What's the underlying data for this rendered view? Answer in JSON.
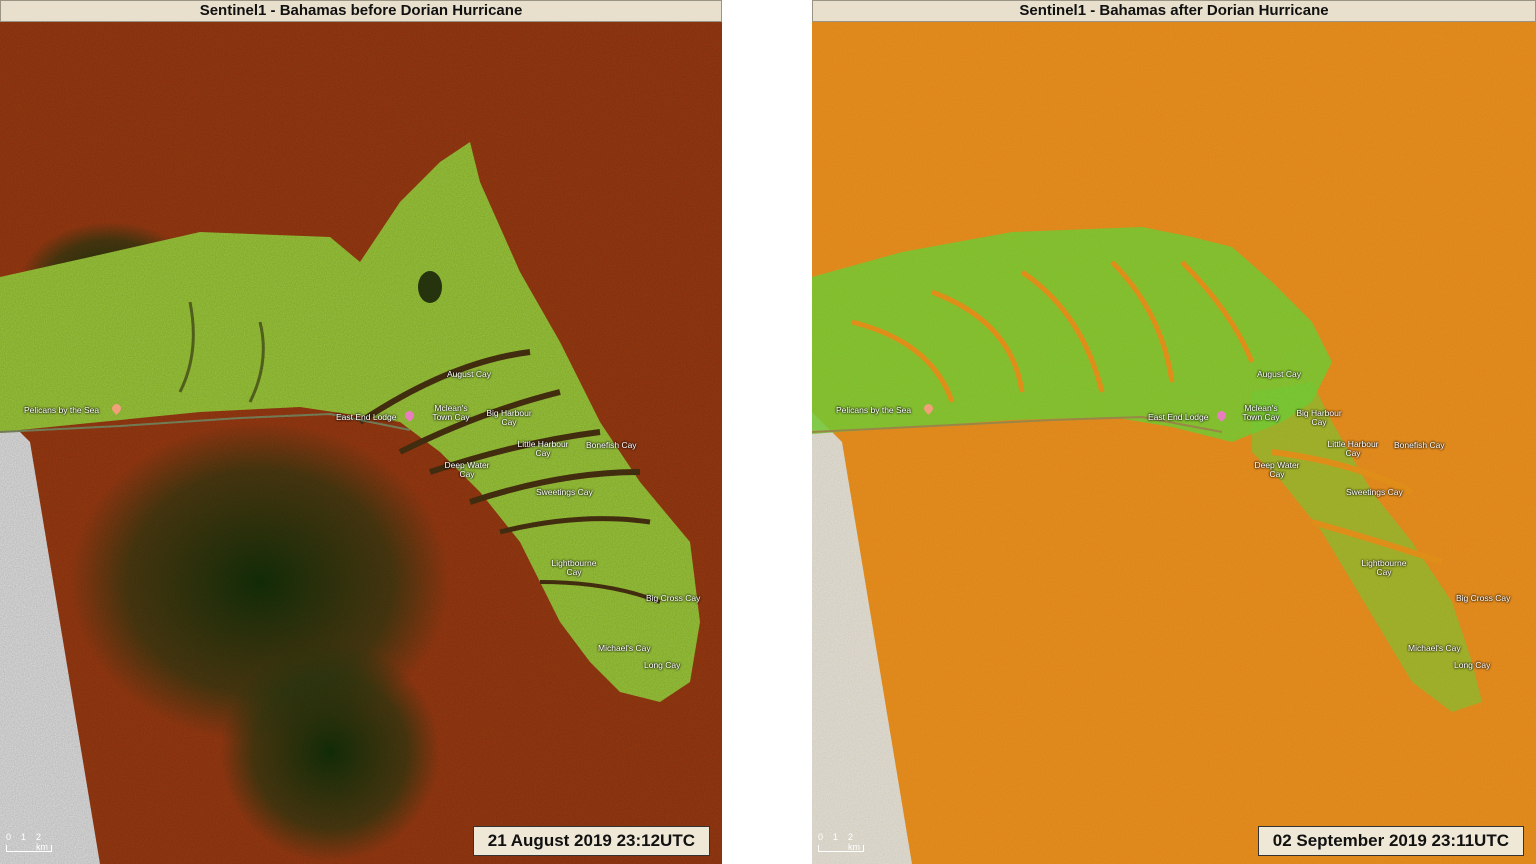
{
  "left": {
    "title": "Sentinel1 - Bahamas before Dorian Hurricane",
    "timestamp": "21 August 2019 23:12UTC",
    "scale": {
      "labels": [
        "0",
        "1",
        "2 km"
      ]
    },
    "colors": {
      "sea": "#9a3a12",
      "sea_dark": "#1f3b10",
      "land": "#9cc83a",
      "channel": "#4a3212",
      "nodata": "#e0e0e0"
    }
  },
  "right": {
    "title": "Sentinel1 - Bahamas after Dorian Hurricane",
    "timestamp": "02 September 2019 23:11UTC",
    "scale": {
      "labels": [
        "0",
        "1",
        "2 km"
      ]
    },
    "colors": {
      "sea": "#e88c20",
      "land": "#6ed23a",
      "channel": "#e8921c",
      "nodata": "#e0e0e0"
    }
  },
  "places": {
    "pelicans": "Pelicans by the Sea",
    "east_end_lodge": "East End Lodge",
    "august_cay": "August Cay",
    "mcleans_town_cay": "Mclean's Town Cay",
    "big_harbour_cay": "Big Harbour Cay",
    "little_harbour_cay": "Little Harbour Cay",
    "bonefish_cay": "Bonefish Cay",
    "deep_water_cay": "Deep Water Cay",
    "sweetings_cay": "Sweetings Cay",
    "lightbourne_cay": "Lightbourne Cay",
    "big_cross_cay": "Big Cross Cay",
    "michaels_cay": "Michael's Cay",
    "long_cay": "Long Cay"
  }
}
